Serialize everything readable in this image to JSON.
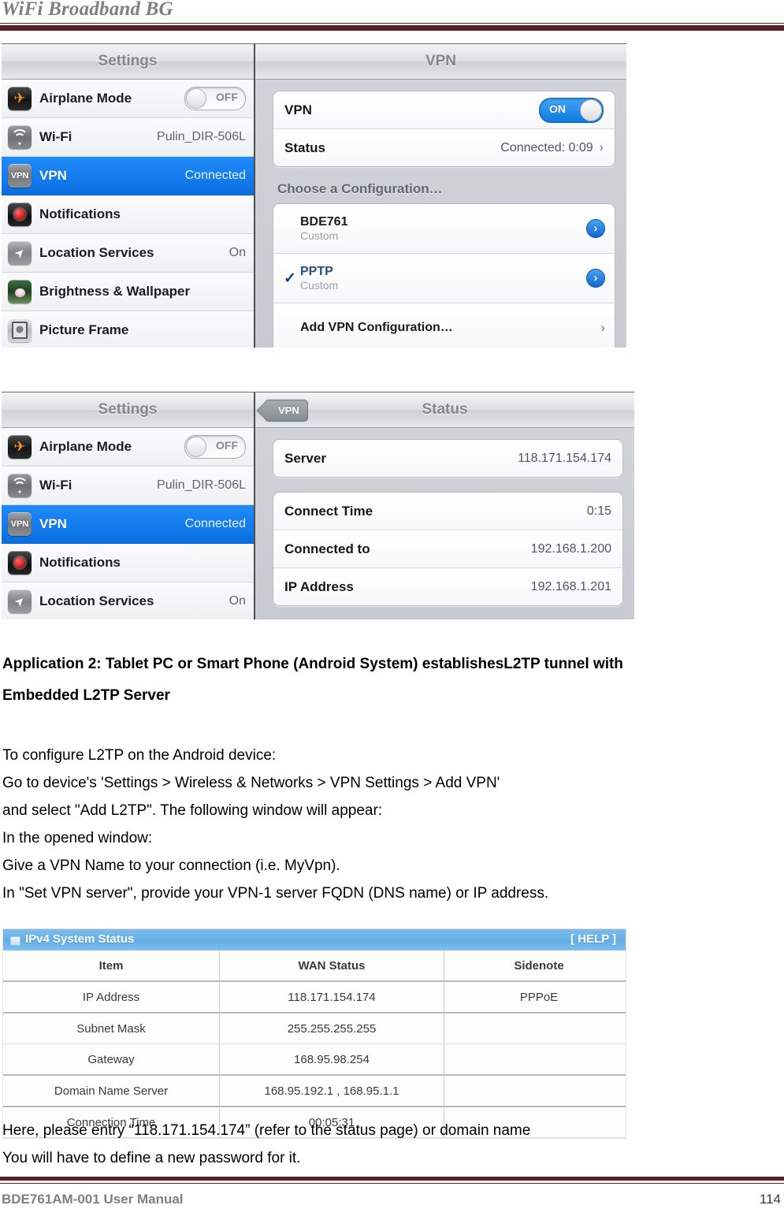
{
  "header": {
    "title": "WiFi Broadband BG"
  },
  "screenshot_vpn": {
    "settings_pane": {
      "title": "Settings",
      "rows": [
        {
          "label": "Airplane Mode",
          "value": "OFF",
          "icon": "airplane-icon",
          "control": "toggle-off"
        },
        {
          "label": "Wi-Fi",
          "value": "Pulin_DIR-506L",
          "icon": "wifi-icon",
          "control": "value"
        },
        {
          "label": "VPN",
          "value": "Connected",
          "icon": "vpn-icon",
          "control": "value",
          "selected": true
        },
        {
          "label": "Notifications",
          "value": "",
          "icon": "notifications-icon",
          "control": "value"
        },
        {
          "label": "Location Services",
          "value": "On",
          "icon": "location-icon",
          "control": "value"
        },
        {
          "label": "Brightness & Wallpaper",
          "value": "",
          "icon": "brightness-icon",
          "control": "value"
        },
        {
          "label": "Picture Frame",
          "value": "",
          "icon": "picture-frame-icon",
          "control": "value"
        }
      ]
    },
    "detail_pane": {
      "title": "VPN",
      "vpn_row": {
        "label": "VPN",
        "toggle_value": "ON"
      },
      "status_row": {
        "label": "Status",
        "value": "Connected: 0:09",
        "chevron": "›"
      },
      "choose_heading": "Choose a Configuration…",
      "configs": [
        {
          "name": "BDE761",
          "subtitle": "Custom",
          "checked": false,
          "arrow": "›"
        },
        {
          "name": "PPTP",
          "subtitle": "Custom",
          "checked": true,
          "check_glyph": "✓",
          "arrow": "›"
        }
      ],
      "add_config": {
        "label": "Add VPN Configuration…",
        "arrow": "›"
      }
    }
  },
  "screenshot_status": {
    "settings_pane": {
      "title": "Settings",
      "rows": [
        {
          "label": "Airplane Mode",
          "value": "OFF",
          "icon": "airplane-icon",
          "control": "toggle-off"
        },
        {
          "label": "Wi-Fi",
          "value": "Pulin_DIR-506L",
          "icon": "wifi-icon",
          "control": "value"
        },
        {
          "label": "VPN",
          "value": "Connected",
          "icon": "vpn-icon",
          "control": "value",
          "selected": true
        },
        {
          "label": "Notifications",
          "value": "",
          "icon": "notifications-icon",
          "control": "value"
        },
        {
          "label": "Location Services",
          "value": "On",
          "icon": "location-icon",
          "control": "value"
        }
      ]
    },
    "detail_pane": {
      "title": "Status",
      "back_button": "VPN",
      "group_a": [
        {
          "label": "Server",
          "value": "118.171.154.174"
        }
      ],
      "group_b": [
        {
          "label": "Connect Time",
          "value": "0:15"
        },
        {
          "label": "Connected to",
          "value": "192.168.1.200"
        },
        {
          "label": "IP Address",
          "value": "192.168.1.201"
        }
      ]
    }
  },
  "body": {
    "heading_line1": "Application 2: Tablet PC or Smart Phone (Android System) establishesL2TP tunnel with",
    "heading_line2": "Embedded L2TP Server",
    "lines": [
      "To configure L2TP on the Android device:",
      "Go to device's 'Settings > Wireless & Networks > VPN Settings > Add VPN'",
      "and select \"Add L2TP\". The following window will appear:",
      "In the opened window:",
      "Give a VPN Name to your connection (i.e. MyVpn).",
      "In \"Set VPN server\", provide your VPN-1 server FQDN (DNS name) or IP address."
    ],
    "after_table_lines": [
      "Here, please entry “118.171.154.174” (refer to the status page) or domain name",
      "You will have to define a new password for it."
    ]
  },
  "status_table": {
    "title": "IPv4 System Status",
    "help_label": "[ HELP ]",
    "columns": [
      "Item",
      "WAN Status",
      "Sidenote"
    ],
    "rows": [
      {
        "item": "IP Address",
        "wan": "118.171.154.174",
        "sidenote": "PPPoE",
        "wan_blue": true
      },
      {
        "item": "Subnet Mask",
        "wan": "255.255.255.255",
        "sidenote": "",
        "wan_blue": true
      },
      {
        "item": "Gateway",
        "wan": "168.95.98.254",
        "sidenote": "",
        "wan_blue": true
      },
      {
        "item": "Domain Name Server",
        "wan": "168.95.192.1 , 168.95.1.1",
        "sidenote": "",
        "wan_blue": true
      },
      {
        "item": "Connection Time",
        "wan": "00:05:31",
        "sidenote": "",
        "wan_blue": false
      }
    ]
  },
  "footer": {
    "left": "BDE761AM-001   User Manual",
    "page": "114"
  },
  "colors": {
    "rule": "#5B2223",
    "header_text": "#7f7f7f",
    "ios_selected": "#0a6fe0",
    "table_header": "#64aee6",
    "table_value": "#3333cc"
  }
}
